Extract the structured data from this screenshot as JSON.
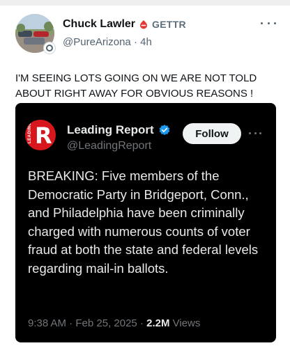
{
  "post": {
    "display_name": "Chuck Lawler",
    "platform_label": "GETTR",
    "handle": "@PureArizona",
    "separator": "·",
    "time": "4h",
    "text": "I'M SEEING LOTS GOING ON WE ARE NOT TOLD ABOUT RIGHT AWAY FOR OBVIOUS REASONS !",
    "icons": {
      "more": "more-horizontal-icon",
      "platform": "gettr-logo-icon",
      "avatar_badge": "camera-lens-badge-icon"
    }
  },
  "embed": {
    "display_name": "Leading Report",
    "handle": "@LeadingReport",
    "follow_label": "Follow",
    "logo_letter": "R",
    "logo_side_text": "LEADING",
    "body": "BREAKING: Five members of the Democratic Party in Bridgeport, Conn., and Philadelphia have been criminally charged with numerous counts of voter fraud at both the state and federal levels regarding mail-in ballots.",
    "timestamp": "9:38 AM · Feb 25, 2025 ·",
    "views_count": "2.2M",
    "views_label": "Views",
    "colors": {
      "logo": "#d8161d",
      "verified": "#1d9bf0",
      "background": "#000000"
    }
  }
}
